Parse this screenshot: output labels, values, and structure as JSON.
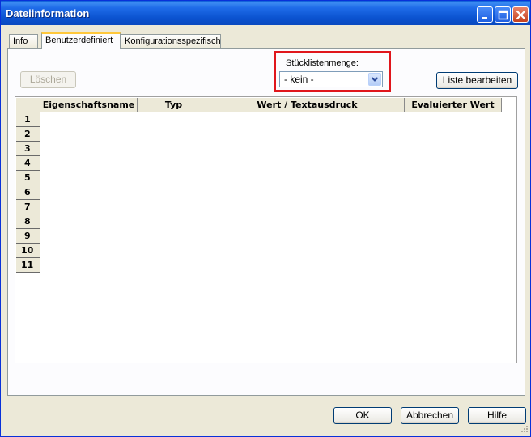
{
  "window": {
    "title": "Dateiinformation",
    "colors": {
      "titlebar": "#0b53d0",
      "highlight_box": "#e0161c",
      "face": "#ece9d8"
    }
  },
  "tabs": [
    {
      "label": "Info",
      "active": false
    },
    {
      "label": "Benutzerdefiniert",
      "active": true
    },
    {
      "label": "Konfigurationsspezifisch",
      "active": false
    }
  ],
  "toolbar": {
    "delete_label": "Löschen",
    "bom_quantity_label": "Stücklistenmenge:",
    "bom_quantity_value": "- kein -",
    "edit_list_label": "Liste bearbeiten"
  },
  "table": {
    "columns": [
      "Eigenschaftsname",
      "Typ",
      "Wert / Textausdruck",
      "Evaluierter Wert"
    ],
    "rows": [
      "1",
      "2",
      "3",
      "4",
      "5",
      "6",
      "7",
      "8",
      "9",
      "10",
      "11"
    ]
  },
  "footer": {
    "ok_label": "OK",
    "cancel_label": "Abbrechen",
    "help_label": "Hilfe"
  }
}
